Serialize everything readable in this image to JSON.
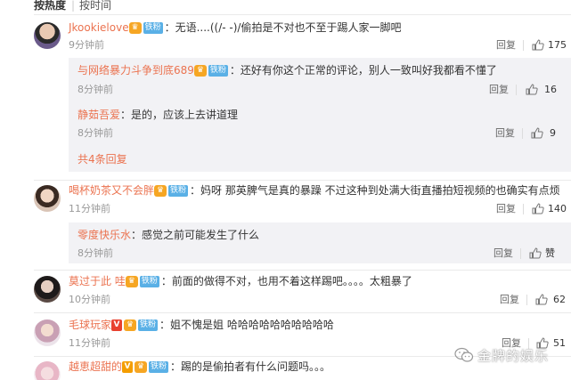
{
  "sort": {
    "hot": "按热度",
    "time": "按时间",
    "sep": "|"
  },
  "ops": {
    "reply": "回复"
  },
  "comments": [
    {
      "user": "Jkookielove",
      "text": "：无语....((/- -)/偷拍是不对也不至于踢人家一脚吧",
      "time": "9分钟前",
      "likes": "175",
      "badge_tie": "铁粉"
    },
    {
      "user": "与网络暴力斗争到底689",
      "text": "：还好有你这个正常的评论，别人一致叫好我都看不懂了",
      "time": "8分钟前",
      "likes": "16",
      "badge_tie": "铁粉"
    },
    {
      "user": "静茹吾爱",
      "text": "：是的，应该上去讲道理",
      "time": "8分钟前",
      "likes": "9"
    },
    {
      "more": "共4条回复"
    },
    {
      "user": "喝杯奶茶又不会胖",
      "text": "：妈呀 那英脾气是真的暴躁 不过这种到处满大街直播拍短视频的也确实有点烦",
      "time": "11分钟前",
      "likes": "140",
      "badge_tie": "铁粉"
    },
    {
      "user": "零度快乐水",
      "text": "：感觉之前可能发生了什么",
      "time": "8分钟前",
      "likes": "赞"
    },
    {
      "user": "莫过于此 哇",
      "text": "：前面的做得不对，也用不着这样踢吧。。。。太粗暴了",
      "time": "10分钟前",
      "likes": "62",
      "badge_tie": "铁粉"
    },
    {
      "user": "毛球玩家",
      "text": "：姐不愧是姐 哈哈哈哈哈哈哈哈哈哈",
      "time": "11分钟前",
      "likes": "51",
      "badge_tie": "铁粉",
      "badge_v": "V"
    },
    {
      "user": "越恵超甜的",
      "text": "：踢的是偷拍者有什么问题吗。。。",
      "badge_tie": "铁粉",
      "badge_v": "V"
    }
  ],
  "watermark": {
    "text": "金牌的娱乐"
  },
  "colors": {
    "username": "#eb7350",
    "sub_bg": "#f2f2f5",
    "badge_tie": "#5ab0e6",
    "badge_crown": "#f6a623"
  }
}
